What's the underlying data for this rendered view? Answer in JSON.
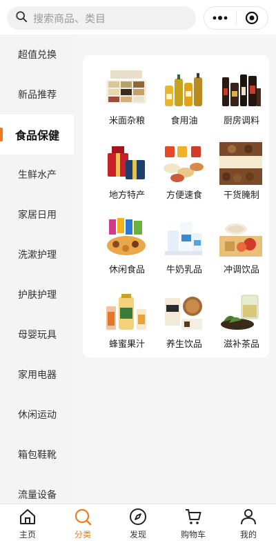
{
  "search": {
    "placeholder": "搜索商品、类目"
  },
  "sidebar": {
    "items": [
      {
        "label": "超值兑换"
      },
      {
        "label": "新品推荐"
      },
      {
        "label": "食品保健"
      },
      {
        "label": "生鲜水产"
      },
      {
        "label": "家居日用"
      },
      {
        "label": "洗漱护理"
      },
      {
        "label": "护肤护理"
      },
      {
        "label": "母婴玩具"
      },
      {
        "label": "家用电器"
      },
      {
        "label": "休闲运动"
      },
      {
        "label": "箱包鞋靴"
      },
      {
        "label": "流量设备"
      }
    ],
    "active_index": 2
  },
  "categories": [
    {
      "label": "米面杂粮",
      "icon": "grains-image"
    },
    {
      "label": "食用油",
      "icon": "cooking-oil-image"
    },
    {
      "label": "厨房调料",
      "icon": "seasoning-image"
    },
    {
      "label": "地方特产",
      "icon": "gift-box-image"
    },
    {
      "label": "方便速食",
      "icon": "instant-food-image"
    },
    {
      "label": "干货腌制",
      "icon": "dried-goods-image"
    },
    {
      "label": "休闲食品",
      "icon": "snacks-image"
    },
    {
      "label": "牛奶乳品",
      "icon": "milk-image"
    },
    {
      "label": "冲调饮品",
      "icon": "brewed-drink-image"
    },
    {
      "label": "蜂蜜果汁",
      "icon": "honey-juice-image"
    },
    {
      "label": "养生饮品",
      "icon": "health-drink-image"
    },
    {
      "label": "滋补茶品",
      "icon": "tea-image"
    }
  ],
  "tabbar": {
    "items": [
      {
        "label": "主页",
        "icon": "home-icon"
      },
      {
        "label": "分类",
        "icon": "category-search-icon"
      },
      {
        "label": "发现",
        "icon": "compass-icon"
      },
      {
        "label": "购物车",
        "icon": "cart-icon"
      },
      {
        "label": "我的",
        "icon": "profile-icon"
      }
    ],
    "active_index": 1
  },
  "colors": {
    "accent": "#f07b1e",
    "background": "#f3f3f3",
    "panel": "#ffffff"
  }
}
